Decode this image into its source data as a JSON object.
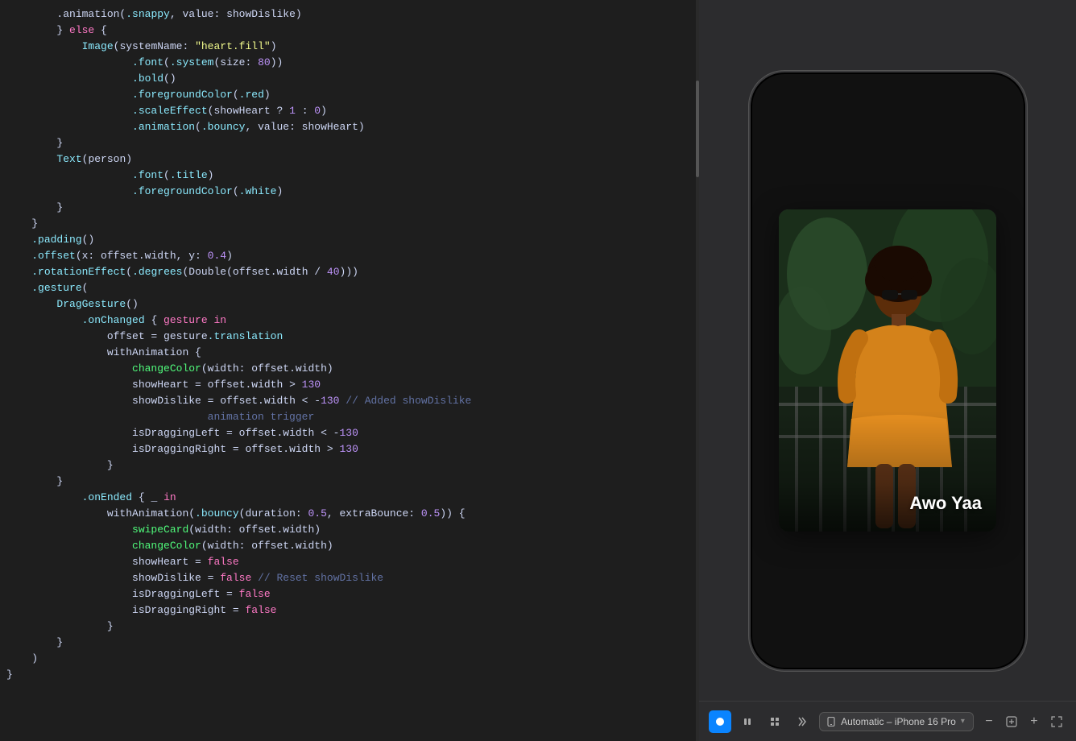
{
  "editor": {
    "lines": [
      {
        "id": 1,
        "indent": 2,
        "tokens": [
          {
            "t": "plain",
            "v": ".animation("
          },
          {
            "t": "prop",
            "v": ".snappy"
          },
          {
            "t": "plain",
            "v": ", value: showDislike)"
          }
        ]
      },
      {
        "id": 2,
        "indent": 2,
        "tokens": [
          {
            "t": "plain",
            "v": "} "
          },
          {
            "t": "kw",
            "v": "else"
          },
          {
            "t": "plain",
            "v": " {"
          }
        ]
      },
      {
        "id": 3,
        "indent": 3,
        "tokens": [
          {
            "t": "type",
            "v": "Image"
          },
          {
            "t": "plain",
            "v": "(systemName: "
          },
          {
            "t": "str",
            "v": "\"heart.fill\""
          },
          {
            "t": "plain",
            "v": ")"
          }
        ]
      },
      {
        "id": 4,
        "indent": 5,
        "tokens": [
          {
            "t": "prop",
            "v": ".font"
          },
          {
            "t": "plain",
            "v": "("
          },
          {
            "t": "prop",
            "v": ".system"
          },
          {
            "t": "plain",
            "v": "(size: "
          },
          {
            "t": "num",
            "v": "80"
          },
          {
            "t": "plain",
            "v": "))"
          }
        ]
      },
      {
        "id": 5,
        "indent": 5,
        "tokens": [
          {
            "t": "prop",
            "v": ".bold"
          },
          {
            "t": "plain",
            "v": "()"
          }
        ]
      },
      {
        "id": 6,
        "indent": 5,
        "tokens": [
          {
            "t": "prop",
            "v": ".foregroundColor"
          },
          {
            "t": "plain",
            "v": "("
          },
          {
            "t": "prop",
            "v": ".red"
          },
          {
            "t": "plain",
            "v": ")"
          }
        ]
      },
      {
        "id": 7,
        "indent": 5,
        "tokens": [
          {
            "t": "prop",
            "v": ".scaleEffect"
          },
          {
            "t": "plain",
            "v": "(showHeart ? "
          },
          {
            "t": "num",
            "v": "1"
          },
          {
            "t": "plain",
            "v": " : "
          },
          {
            "t": "num",
            "v": "0"
          },
          {
            "t": "plain",
            "v": ")"
          }
        ]
      },
      {
        "id": 8,
        "indent": 5,
        "tokens": [
          {
            "t": "prop",
            "v": ".animation"
          },
          {
            "t": "plain",
            "v": "("
          },
          {
            "t": "prop",
            "v": ".bouncy"
          },
          {
            "t": "plain",
            "v": ", value: showHeart)"
          }
        ]
      },
      {
        "id": 9,
        "indent": 2,
        "tokens": [
          {
            "t": "plain",
            "v": "}"
          }
        ]
      },
      {
        "id": 10,
        "indent": 2,
        "tokens": [
          {
            "t": "type",
            "v": "Text"
          },
          {
            "t": "plain",
            "v": "(person)"
          }
        ]
      },
      {
        "id": 11,
        "indent": 5,
        "tokens": [
          {
            "t": "prop",
            "v": ".font"
          },
          {
            "t": "plain",
            "v": "("
          },
          {
            "t": "prop",
            "v": ".title"
          },
          {
            "t": "plain",
            "v": ")"
          }
        ]
      },
      {
        "id": 12,
        "indent": 5,
        "tokens": [
          {
            "t": "prop",
            "v": ".foregroundColor"
          },
          {
            "t": "plain",
            "v": "("
          },
          {
            "t": "prop",
            "v": ".white"
          },
          {
            "t": "plain",
            "v": ")"
          }
        ]
      },
      {
        "id": 13,
        "indent": 2,
        "tokens": [
          {
            "t": "plain",
            "v": "}"
          }
        ]
      },
      {
        "id": 14,
        "indent": 1,
        "tokens": [
          {
            "t": "plain",
            "v": "}"
          }
        ]
      },
      {
        "id": 15,
        "indent": 1,
        "tokens": [
          {
            "t": "prop",
            "v": ".padding"
          },
          {
            "t": "plain",
            "v": "()"
          }
        ]
      },
      {
        "id": 16,
        "indent": 1,
        "tokens": [
          {
            "t": "prop",
            "v": ".offset"
          },
          {
            "t": "plain",
            "v": "(x: offset.width, y: "
          },
          {
            "t": "num",
            "v": "0.4"
          },
          {
            "t": "plain",
            "v": ")"
          }
        ]
      },
      {
        "id": 17,
        "indent": 1,
        "tokens": [
          {
            "t": "prop",
            "v": ".rotationEffect"
          },
          {
            "t": "plain",
            "v": "("
          },
          {
            "t": "prop",
            "v": ".degrees"
          },
          {
            "t": "plain",
            "v": "(Double(offset.width / "
          },
          {
            "t": "num",
            "v": "40"
          },
          {
            "t": "plain",
            "v": ")))"
          }
        ]
      },
      {
        "id": 18,
        "indent": 1,
        "tokens": [
          {
            "t": "prop",
            "v": ".gesture"
          },
          {
            "t": "plain",
            "v": "("
          }
        ]
      },
      {
        "id": 19,
        "indent": 2,
        "tokens": [
          {
            "t": "type",
            "v": "DragGesture"
          },
          {
            "t": "plain",
            "v": "()"
          }
        ]
      },
      {
        "id": 20,
        "indent": 3,
        "tokens": [
          {
            "t": "prop",
            "v": ".onChanged"
          },
          {
            "t": "plain",
            "v": " { "
          },
          {
            "t": "kw",
            "v": "gesture"
          },
          {
            "t": "plain",
            "v": " "
          },
          {
            "t": "kw",
            "v": "in"
          }
        ]
      },
      {
        "id": 21,
        "indent": 4,
        "tokens": [
          {
            "t": "plain",
            "v": "offset = gesture"
          },
          {
            "t": "prop",
            "v": ".translation"
          }
        ]
      },
      {
        "id": 22,
        "indent": 4,
        "tokens": [
          {
            "t": "plain",
            "v": "withAnimation {"
          }
        ]
      },
      {
        "id": 23,
        "indent": 5,
        "tokens": [
          {
            "t": "fn",
            "v": "changeColor"
          },
          {
            "t": "plain",
            "v": "(width: offset.width)"
          }
        ]
      },
      {
        "id": 24,
        "indent": 5,
        "tokens": [
          {
            "t": "plain",
            "v": "showHeart = offset.width > "
          },
          {
            "t": "num",
            "v": "130"
          }
        ]
      },
      {
        "id": 25,
        "indent": 5,
        "tokens": [
          {
            "t": "plain",
            "v": "showDislike = offset.width < -"
          },
          {
            "t": "num",
            "v": "130"
          },
          {
            "t": "plain",
            "v": " "
          },
          {
            "t": "cmt",
            "v": "// Added showDislike"
          }
        ]
      },
      {
        "id": 26,
        "indent": 8,
        "tokens": [
          {
            "t": "cmt",
            "v": "animation trigger"
          }
        ]
      },
      {
        "id": 27,
        "indent": 5,
        "tokens": [
          {
            "t": "plain",
            "v": "isDraggingLeft = offset.width < -"
          },
          {
            "t": "num",
            "v": "130"
          }
        ]
      },
      {
        "id": 28,
        "indent": 5,
        "tokens": [
          {
            "t": "plain",
            "v": "isDraggingRight = offset.width > "
          },
          {
            "t": "num",
            "v": "130"
          }
        ]
      },
      {
        "id": 29,
        "indent": 4,
        "tokens": [
          {
            "t": "plain",
            "v": "}"
          }
        ]
      },
      {
        "id": 30,
        "indent": 2,
        "tokens": [
          {
            "t": "plain",
            "v": "}"
          }
        ]
      },
      {
        "id": 31,
        "indent": 3,
        "tokens": [
          {
            "t": "prop",
            "v": ".onEnded"
          },
          {
            "t": "plain",
            "v": " { _ "
          },
          {
            "t": "kw",
            "v": "in"
          }
        ]
      },
      {
        "id": 32,
        "indent": 4,
        "tokens": [
          {
            "t": "plain",
            "v": "withAnimation("
          },
          {
            "t": "prop",
            "v": ".bouncy"
          },
          {
            "t": "plain",
            "v": "(duration: "
          },
          {
            "t": "num",
            "v": "0.5"
          },
          {
            "t": "plain",
            "v": ", extraBounce: "
          },
          {
            "t": "num",
            "v": "0.5"
          },
          {
            "t": "plain",
            "v": ")) {"
          }
        ]
      },
      {
        "id": 33,
        "indent": 5,
        "tokens": [
          {
            "t": "fn",
            "v": "swipeCard"
          },
          {
            "t": "plain",
            "v": "(width: offset.width)"
          }
        ]
      },
      {
        "id": 34,
        "indent": 5,
        "tokens": [
          {
            "t": "fn",
            "v": "changeColor"
          },
          {
            "t": "plain",
            "v": "(width: offset.width)"
          }
        ]
      },
      {
        "id": 35,
        "indent": 5,
        "tokens": [
          {
            "t": "plain",
            "v": "showHeart = "
          },
          {
            "t": "kw",
            "v": "false"
          }
        ]
      },
      {
        "id": 36,
        "indent": 5,
        "tokens": [
          {
            "t": "plain",
            "v": "showDislike = "
          },
          {
            "t": "kw",
            "v": "false"
          },
          {
            "t": "plain",
            "v": " "
          },
          {
            "t": "cmt",
            "v": "// Reset showDislike"
          }
        ]
      },
      {
        "id": 37,
        "indent": 5,
        "tokens": [
          {
            "t": "plain",
            "v": "isDraggingLeft = "
          },
          {
            "t": "kw",
            "v": "false"
          }
        ]
      },
      {
        "id": 38,
        "indent": 5,
        "tokens": [
          {
            "t": "plain",
            "v": "isDraggingRight = "
          },
          {
            "t": "kw",
            "v": "false"
          }
        ]
      },
      {
        "id": 39,
        "indent": 4,
        "tokens": [
          {
            "t": "plain",
            "v": "}"
          }
        ]
      },
      {
        "id": 40,
        "indent": 2,
        "tokens": [
          {
            "t": "plain",
            "v": "}"
          }
        ]
      },
      {
        "id": 41,
        "indent": 1,
        "tokens": [
          {
            "t": "plain",
            "v": ")"
          }
        ]
      },
      {
        "id": 42,
        "indent": 0,
        "tokens": [
          {
            "t": "plain",
            "v": "}"
          }
        ]
      }
    ]
  },
  "preview": {
    "card": {
      "name": "Awo Yaa"
    }
  },
  "toolbar": {
    "device_label": "Automatic – iPhone 16 Pro",
    "chevron_icon": "▾",
    "zoom_minus_icon": "−",
    "zoom_reset_icon": "⊡",
    "zoom_plus_icon": "+",
    "zoom_fit_icon": "⤢"
  }
}
